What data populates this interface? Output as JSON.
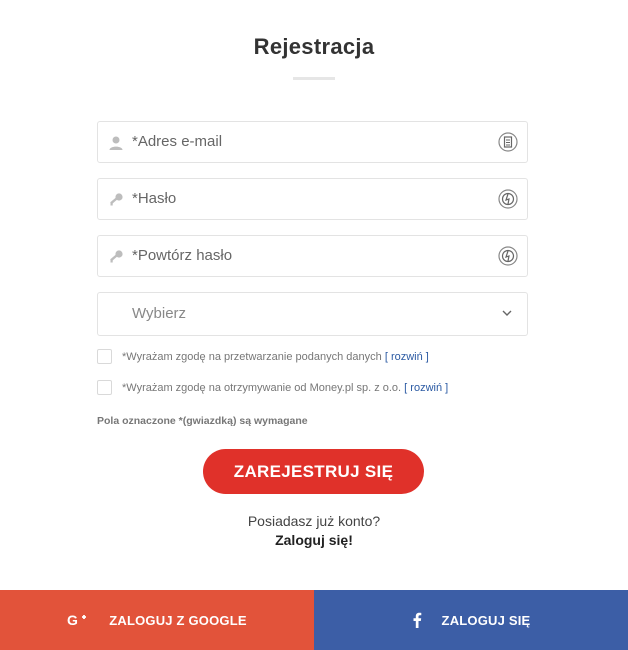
{
  "form": {
    "title": "Rejestracja",
    "email_placeholder": "*Adres e-mail",
    "password_placeholder": "*Hasło",
    "repeat_password_placeholder": "*Powtórz hasło",
    "select_value": "Wybierz",
    "consent1_text": "*Wyrażam zgodę na przetwarzanie podanych danych",
    "consent1_link": "[ rozwiń ]",
    "consent2_text": "*Wyrażam zgodę na otrzymywanie od Money.pl sp. z o.o.",
    "consent2_link": "[ rozwiń ]",
    "required_note": "Pola oznaczone *(gwiazdką) są wymagane",
    "register_label": "ZAREJESTRUJ SIĘ",
    "has_account": "Posiadasz już konto?",
    "login_label": "Zaloguj się!"
  },
  "social": {
    "google_label": "ZALOGUJ Z GOOGLE",
    "facebook_label": "ZALOGUJ SIĘ"
  },
  "colors": {
    "accent": "#e0312a",
    "google": "#e2533a",
    "facebook": "#3c5ea6",
    "link": "#2b5aa3"
  },
  "icons": [
    "user-icon",
    "contact-card-icon",
    "key-icon",
    "password-reveal-icon",
    "chevron-down-icon",
    "google-plus-icon",
    "facebook-icon"
  ]
}
